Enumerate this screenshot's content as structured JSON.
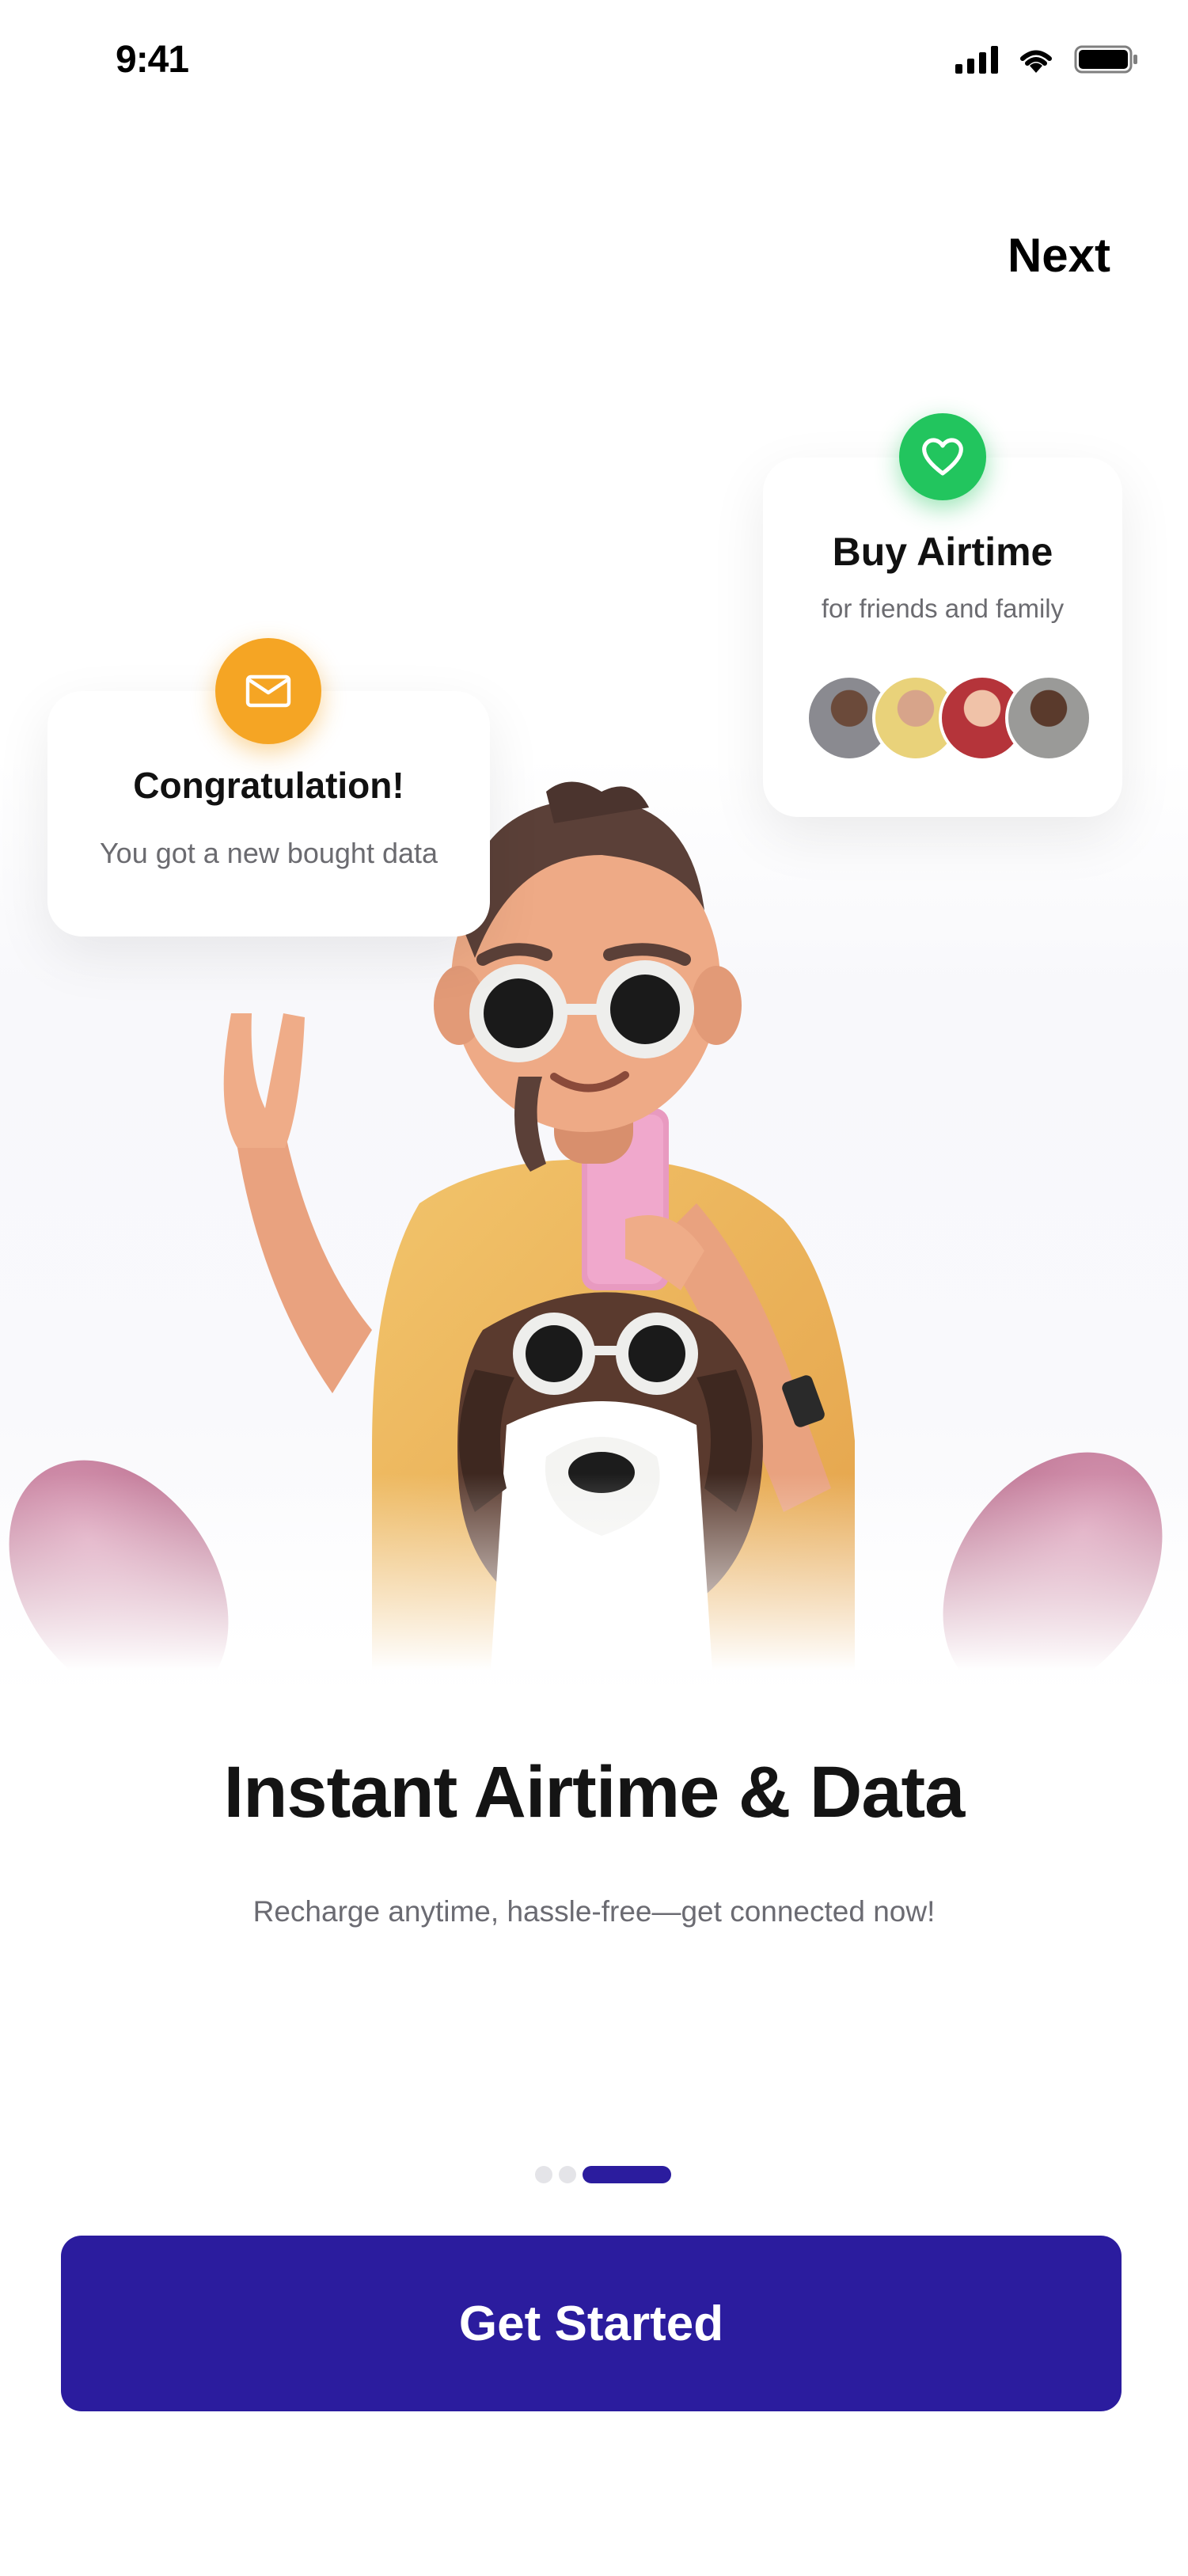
{
  "status_bar": {
    "time": "9:41"
  },
  "header": {
    "next_label": "Next"
  },
  "cards": {
    "congrats": {
      "title": "Congratulation!",
      "subtitle": "You got a new bought data"
    },
    "airtime": {
      "title": "Buy Airtime",
      "subtitle": "for friends and family"
    }
  },
  "hero": {
    "title": "Instant Airtime & Data",
    "subtitle": "Recharge anytime, hassle-free—get connected now!"
  },
  "pager": {
    "total": 3,
    "active_index": 3
  },
  "cta": {
    "label": "Get Started"
  },
  "colors": {
    "primary": "#2b1c9e",
    "orange_badge": "#f5a524",
    "green_badge": "#22c55e"
  },
  "icons": {
    "congrats_badge": "mail-icon",
    "airtime_badge": "heart-icon"
  }
}
